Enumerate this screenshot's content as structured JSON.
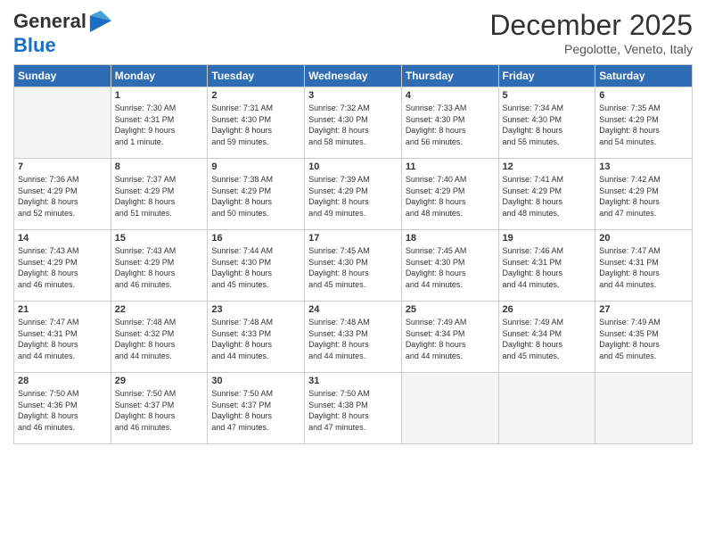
{
  "header": {
    "logo_line1": "General",
    "logo_line2": "Blue",
    "month_title": "December 2025",
    "location": "Pegolotte, Veneto, Italy"
  },
  "days_of_week": [
    "Sunday",
    "Monday",
    "Tuesday",
    "Wednesday",
    "Thursday",
    "Friday",
    "Saturday"
  ],
  "weeks": [
    [
      {
        "day": "",
        "info": ""
      },
      {
        "day": "1",
        "info": "Sunrise: 7:30 AM\nSunset: 4:31 PM\nDaylight: 9 hours\nand 1 minute."
      },
      {
        "day": "2",
        "info": "Sunrise: 7:31 AM\nSunset: 4:30 PM\nDaylight: 8 hours\nand 59 minutes."
      },
      {
        "day": "3",
        "info": "Sunrise: 7:32 AM\nSunset: 4:30 PM\nDaylight: 8 hours\nand 58 minutes."
      },
      {
        "day": "4",
        "info": "Sunrise: 7:33 AM\nSunset: 4:30 PM\nDaylight: 8 hours\nand 56 minutes."
      },
      {
        "day": "5",
        "info": "Sunrise: 7:34 AM\nSunset: 4:30 PM\nDaylight: 8 hours\nand 55 minutes."
      },
      {
        "day": "6",
        "info": "Sunrise: 7:35 AM\nSunset: 4:29 PM\nDaylight: 8 hours\nand 54 minutes."
      }
    ],
    [
      {
        "day": "7",
        "info": "Sunrise: 7:36 AM\nSunset: 4:29 PM\nDaylight: 8 hours\nand 52 minutes."
      },
      {
        "day": "8",
        "info": "Sunrise: 7:37 AM\nSunset: 4:29 PM\nDaylight: 8 hours\nand 51 minutes."
      },
      {
        "day": "9",
        "info": "Sunrise: 7:38 AM\nSunset: 4:29 PM\nDaylight: 8 hours\nand 50 minutes."
      },
      {
        "day": "10",
        "info": "Sunrise: 7:39 AM\nSunset: 4:29 PM\nDaylight: 8 hours\nand 49 minutes."
      },
      {
        "day": "11",
        "info": "Sunrise: 7:40 AM\nSunset: 4:29 PM\nDaylight: 8 hours\nand 48 minutes."
      },
      {
        "day": "12",
        "info": "Sunrise: 7:41 AM\nSunset: 4:29 PM\nDaylight: 8 hours\nand 48 minutes."
      },
      {
        "day": "13",
        "info": "Sunrise: 7:42 AM\nSunset: 4:29 PM\nDaylight: 8 hours\nand 47 minutes."
      }
    ],
    [
      {
        "day": "14",
        "info": "Sunrise: 7:43 AM\nSunset: 4:29 PM\nDaylight: 8 hours\nand 46 minutes."
      },
      {
        "day": "15",
        "info": "Sunrise: 7:43 AM\nSunset: 4:29 PM\nDaylight: 8 hours\nand 46 minutes."
      },
      {
        "day": "16",
        "info": "Sunrise: 7:44 AM\nSunset: 4:30 PM\nDaylight: 8 hours\nand 45 minutes."
      },
      {
        "day": "17",
        "info": "Sunrise: 7:45 AM\nSunset: 4:30 PM\nDaylight: 8 hours\nand 45 minutes."
      },
      {
        "day": "18",
        "info": "Sunrise: 7:45 AM\nSunset: 4:30 PM\nDaylight: 8 hours\nand 44 minutes."
      },
      {
        "day": "19",
        "info": "Sunrise: 7:46 AM\nSunset: 4:31 PM\nDaylight: 8 hours\nand 44 minutes."
      },
      {
        "day": "20",
        "info": "Sunrise: 7:47 AM\nSunset: 4:31 PM\nDaylight: 8 hours\nand 44 minutes."
      }
    ],
    [
      {
        "day": "21",
        "info": "Sunrise: 7:47 AM\nSunset: 4:31 PM\nDaylight: 8 hours\nand 44 minutes."
      },
      {
        "day": "22",
        "info": "Sunrise: 7:48 AM\nSunset: 4:32 PM\nDaylight: 8 hours\nand 44 minutes."
      },
      {
        "day": "23",
        "info": "Sunrise: 7:48 AM\nSunset: 4:33 PM\nDaylight: 8 hours\nand 44 minutes."
      },
      {
        "day": "24",
        "info": "Sunrise: 7:48 AM\nSunset: 4:33 PM\nDaylight: 8 hours\nand 44 minutes."
      },
      {
        "day": "25",
        "info": "Sunrise: 7:49 AM\nSunset: 4:34 PM\nDaylight: 8 hours\nand 44 minutes."
      },
      {
        "day": "26",
        "info": "Sunrise: 7:49 AM\nSunset: 4:34 PM\nDaylight: 8 hours\nand 45 minutes."
      },
      {
        "day": "27",
        "info": "Sunrise: 7:49 AM\nSunset: 4:35 PM\nDaylight: 8 hours\nand 45 minutes."
      }
    ],
    [
      {
        "day": "28",
        "info": "Sunrise: 7:50 AM\nSunset: 4:36 PM\nDaylight: 8 hours\nand 46 minutes."
      },
      {
        "day": "29",
        "info": "Sunrise: 7:50 AM\nSunset: 4:37 PM\nDaylight: 8 hours\nand 46 minutes."
      },
      {
        "day": "30",
        "info": "Sunrise: 7:50 AM\nSunset: 4:37 PM\nDaylight: 8 hours\nand 47 minutes."
      },
      {
        "day": "31",
        "info": "Sunrise: 7:50 AM\nSunset: 4:38 PM\nDaylight: 8 hours\nand 47 minutes."
      },
      {
        "day": "",
        "info": ""
      },
      {
        "day": "",
        "info": ""
      },
      {
        "day": "",
        "info": ""
      }
    ]
  ]
}
